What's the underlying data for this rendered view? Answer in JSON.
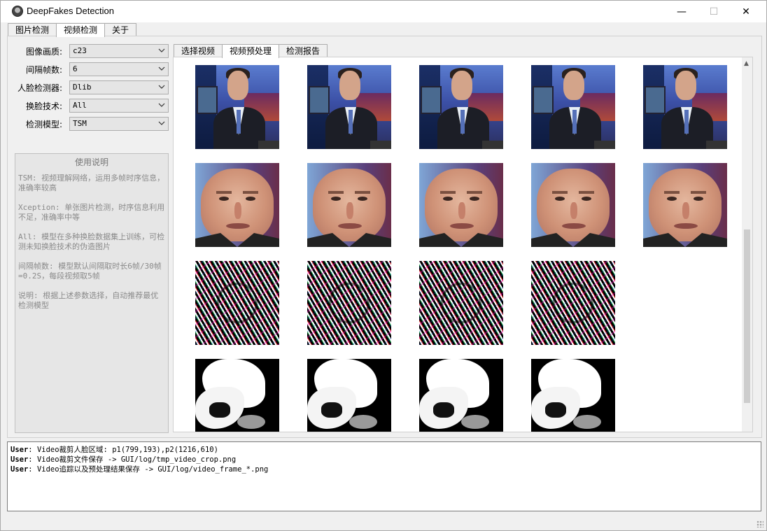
{
  "window": {
    "title": "DeepFakes Detection",
    "controls": {
      "minimize": "—",
      "maximize": "☐",
      "close": "✕"
    }
  },
  "main_tabs": [
    {
      "label": "图片检测",
      "active": false
    },
    {
      "label": "视频检测",
      "active": true
    },
    {
      "label": "关于",
      "active": false
    }
  ],
  "settings": {
    "quality": {
      "label": "图像画质:",
      "value": "c23"
    },
    "interval": {
      "label": "间隔帧数:",
      "value": "6"
    },
    "detector": {
      "label": "人脸检测器:",
      "value": "Dlib"
    },
    "swap_tech": {
      "label": "换脸技术:",
      "value": "All"
    },
    "model": {
      "label": "检测模型:",
      "value": "TSM"
    }
  },
  "help": {
    "title": "使用说明",
    "paragraphs": [
      "TSM: 视频理解网络，运用多帧时序信息，准确率较高",
      "Xception: 单张图片检测，时序信息利用不足，准确率中等",
      "All: 模型在多种换脸数据集上训练，可检测未知换脸技术的伪造图片",
      "间隔帧数: 模型默认间隔取时长6帧/30帧=0.2S，每段视频取5帧",
      "说明: 根据上述参数选择，自动推荐最优检测模型"
    ]
  },
  "sub_tabs": [
    {
      "label": "选择视频",
      "active": false
    },
    {
      "label": "视频预处理",
      "active": true
    },
    {
      "label": "检测报告",
      "active": false
    }
  ],
  "frame_grid": {
    "rows": [
      {
        "kind": "news-frame",
        "count": 5
      },
      {
        "kind": "face-crop",
        "count": 5
      },
      {
        "kind": "diff-map",
        "count": 4
      },
      {
        "kind": "mask-map",
        "count": 4
      }
    ]
  },
  "log": [
    {
      "user": "User",
      "text": ": Video裁剪人脸区域: p1(799,193),p2(1216,610)"
    },
    {
      "user": "User",
      "text": ": Video裁剪文件保存 -> GUI/log/tmp_video_crop.png"
    },
    {
      "user": "User",
      "text": ": Video追踪以及预处理结果保存 -> GUI/log/video_frame_*.png"
    }
  ]
}
